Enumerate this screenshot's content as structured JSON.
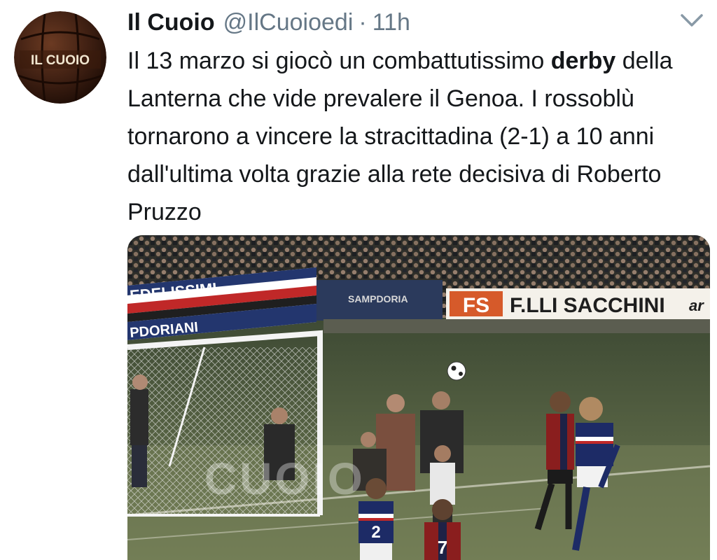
{
  "account": {
    "name": "Il Cuoio",
    "handle": "@IlCuoioedi",
    "separator": "·",
    "time": "11h",
    "avatar_text": "IL CUOIO"
  },
  "tweet": {
    "segments": [
      {
        "text": "Il 13 marzo si giocò un combattutissimo ",
        "bold": false
      },
      {
        "text": "derby",
        "bold": true
      },
      {
        "text": " della Lanterna che vide prevalere il Genoa. I rossoblù tornarono a vincere la stracittadina (2-1) a 10 anni dall'ultima volta grazie alla rete decisiva di Roberto Pruzzo",
        "bold": false
      }
    ]
  },
  "media": {
    "banner_left_top": "EDELISSIMI",
    "banner_left_bottom": "PDORIANI",
    "banner_mid": "SAMPDORIA",
    "ad_logo": "FS",
    "ad_text": "F.LLI SACCHINI",
    "ad_tail": "ar",
    "watermark": "CUOIO",
    "shirt_number_1": "2",
    "shirt_number_2": "7"
  },
  "icons": {
    "more": "chevron-down-icon"
  },
  "colors": {
    "text": "#14171a",
    "secondary": "#657786",
    "pitch": "#5f6b45",
    "sampdoria_blue": "#1d2b66",
    "genoa_red": "#b01e1e"
  }
}
